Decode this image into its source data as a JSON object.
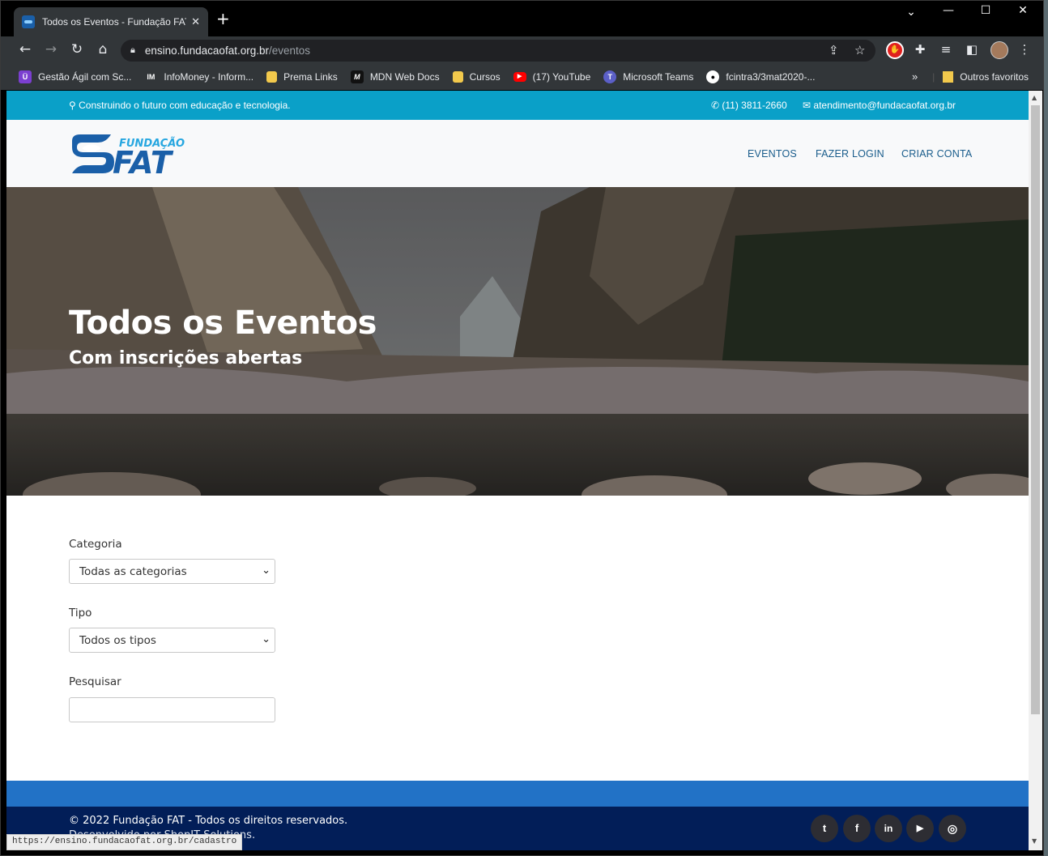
{
  "browser": {
    "tab_title": "Todos os Eventos - Fundação FAT",
    "url_host": "ensino.fundacaofat.org.br",
    "url_path": "/eventos",
    "status_url": "https://ensino.fundacaofat.org.br/cadastro"
  },
  "bookmarks": [
    {
      "label": "Gestão Ágil com Sc...",
      "icon": "shield-icon",
      "color": "#7b3fd0"
    },
    {
      "label": "InfoMoney - Inform...",
      "icon": "infomoney-icon",
      "color": "#323639"
    },
    {
      "label": "Prema Links",
      "icon": "folder-icon",
      "color": "#f2c94c"
    },
    {
      "label": "MDN Web Docs",
      "icon": "mdn-icon",
      "color": "#111111"
    },
    {
      "label": "Cursos",
      "icon": "folder-icon",
      "color": "#f2c94c"
    },
    {
      "label": "(17) YouTube",
      "icon": "youtube-icon",
      "color": "#ff0000"
    },
    {
      "label": "Microsoft Teams",
      "icon": "teams-icon",
      "color": "#5b5fc7"
    },
    {
      "label": "fcintra3/3mat2020-...",
      "icon": "github-icon",
      "color": "#ffffff"
    }
  ],
  "bookmarks_other": "Outros favoritos",
  "topbar": {
    "tagline": "Construindo o futuro com educação e tecnologia.",
    "phone": "(11) 3811-2660",
    "email": "atendimento@fundacaofat.org.br"
  },
  "logo": {
    "line1": "FUNDAÇÃO",
    "line2": "FAT"
  },
  "nav": {
    "eventos": "EVENTOS",
    "login": "FAZER LOGIN",
    "criar": "CRIAR CONTA"
  },
  "hero": {
    "title": "Todos os Eventos",
    "subtitle": "Com inscrições abertas"
  },
  "filters": {
    "categoria_label": "Categoria",
    "categoria_value": "Todas as categorias",
    "tipo_label": "Tipo",
    "tipo_value": "Todos os tipos",
    "pesquisar_label": "Pesquisar",
    "pesquisar_value": ""
  },
  "footer": {
    "copyright": "© 2022 Fundação FAT - Todos os direitos reservados.",
    "developed": "Desenvolvido por ShopIT Solutions."
  },
  "social": [
    "twitter",
    "facebook",
    "linkedin",
    "youtube",
    "instagram"
  ],
  "colors": {
    "topbar": "#0aa0c8",
    "nav_link": "#1a5d8c",
    "footer": "#021e58",
    "footer_stripe": "#2272c6"
  }
}
